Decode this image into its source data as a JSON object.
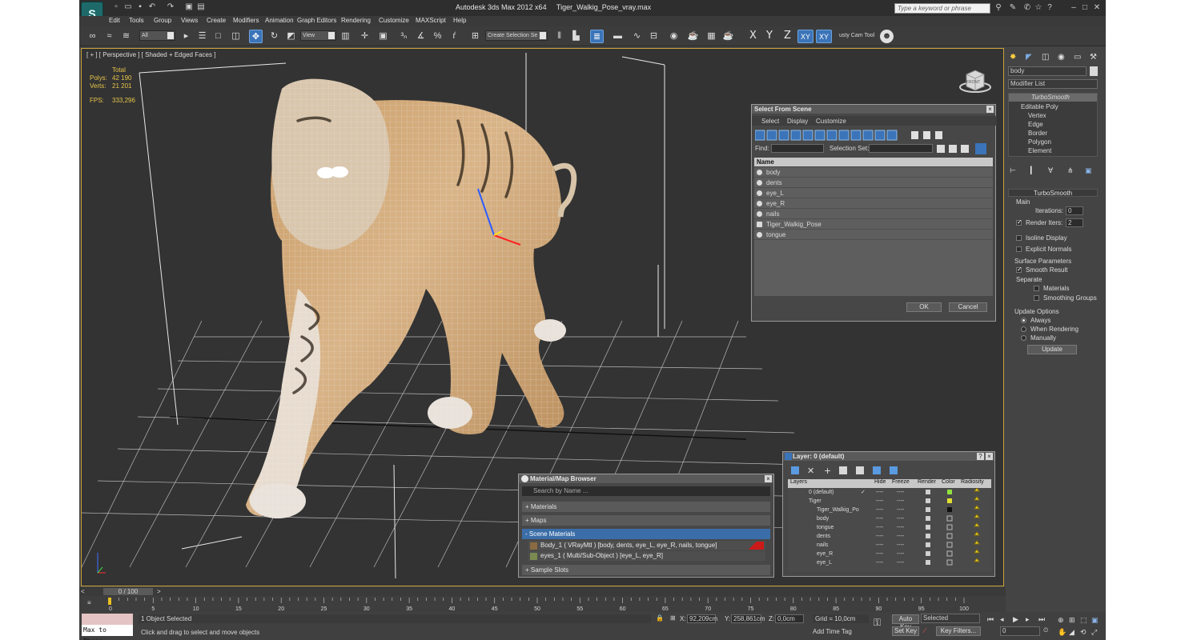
{
  "titlebar": {
    "app_name": "Autodesk 3ds Max  2012 x64",
    "file_name": "Tiger_Walkig_Pose_vray.max",
    "search_placeholder": "Type a keyword or phrase"
  },
  "menu": [
    "Edit",
    "Tools",
    "Group",
    "Views",
    "Create",
    "Modifiers",
    "Animation",
    "Graph Editors",
    "Rendering",
    "Customize",
    "MAXScript",
    "Help"
  ],
  "toolbar": {
    "selection_filter": "All",
    "ref_coord": "View",
    "named_selection": "Create Selection Se",
    "axis_x": "X",
    "axis_y": "Y",
    "axis_z": "Z",
    "axis_xy": "XY",
    "axis_xy2": "XY",
    "camera_tool": "usty Cam Tool"
  },
  "viewport": {
    "label": "[ + ] [ Perspective ] [ Shaded + Edged Faces ]",
    "stats_total": "Total",
    "polys_label": "Polys:",
    "polys_value": "42 190",
    "verts_label": "Verts:",
    "verts_value": "21 201",
    "fps_label": "FPS:",
    "fps_value": "333,296",
    "viewcube_label": "FRONT"
  },
  "select_from_scene": {
    "title": "Select From Scene",
    "menu": [
      "Select",
      "Display",
      "Customize"
    ],
    "find_label": "Find:",
    "selection_set_label": "Selection Set:",
    "column": "Name",
    "items": [
      "body",
      "dents",
      "eye_L",
      "eye_R",
      "nails",
      "Tiger_Walkig_Pose",
      "tongue"
    ],
    "ok": "OK",
    "cancel": "Cancel"
  },
  "material_browser": {
    "title": "Material/Map Browser",
    "search_placeholder": "Search by Name ...",
    "sections": [
      "+ Materials",
      "+ Maps",
      "- Scene Materials",
      "+ Sample Slots"
    ],
    "entries": [
      "Body_1  ( VRayMtl )  [body, dents, eye_L, eye_R, nails, tongue]",
      "eyes_1  ( Multi/Sub-Object )  [eye_L, eye_R]"
    ]
  },
  "layer_dialog": {
    "title": "Layer: 0 (default)",
    "help": "?",
    "columns": [
      "Layers",
      "Hide",
      "Freeze",
      "Render",
      "Color",
      "Radiosity"
    ],
    "rows": [
      "0 (default)",
      "Tiger",
      "Tiger_Walkig_Po",
      "body",
      "tongue",
      "dents",
      "nails",
      "eye_R",
      "eye_L"
    ],
    "dash": "----"
  },
  "command_panel": {
    "object_name": "body",
    "modifier_list": "Modifier List",
    "stack": [
      "TurboSmooth",
      "Editable Poly",
      "Vertex",
      "Edge",
      "Border",
      "Polygon",
      "Element"
    ],
    "rollout": "TurboSmooth",
    "main": "Main",
    "iterations_label": "Iterations:",
    "iterations_value": "0",
    "render_iters_label": "Render Iters:",
    "render_iters_value": "2",
    "isoline": "Isoline Display",
    "explicit_normals": "Explicit Normals",
    "surface_params": "Surface Parameters",
    "smooth_result": "Smooth Result",
    "separate": "Separate",
    "materials": "Materials",
    "smoothing_groups": "Smoothing Groups",
    "update_options": "Update Options",
    "always": "Always",
    "when_rendering": "When Rendering",
    "manually": "Manually",
    "update": "Update"
  },
  "timeline": {
    "frame_counter": "0 / 100",
    "ticks": [
      "0",
      "5",
      "10",
      "15",
      "20",
      "25",
      "30",
      "35",
      "40",
      "45",
      "50",
      "55",
      "60",
      "65",
      "70",
      "75",
      "80",
      "85",
      "90",
      "95",
      "100"
    ]
  },
  "status": {
    "script_label": "Max to Physc.",
    "selected": "1 Object Selected",
    "prompt": "Click and drag to select and move objects",
    "x_label": "X:",
    "x_value": "92,209cm",
    "y_label": "Y:",
    "y_value": "258,861cm",
    "z_label": "Z:",
    "z_value": "0,0cm",
    "grid": "Grid = 10,0cm",
    "add_time_tag": "Add Time Tag",
    "auto_key": "Auto Key",
    "set_key": "Set Key",
    "key_mode": "Selected",
    "key_filters": "Key Filters...",
    "current_frame": "0"
  }
}
